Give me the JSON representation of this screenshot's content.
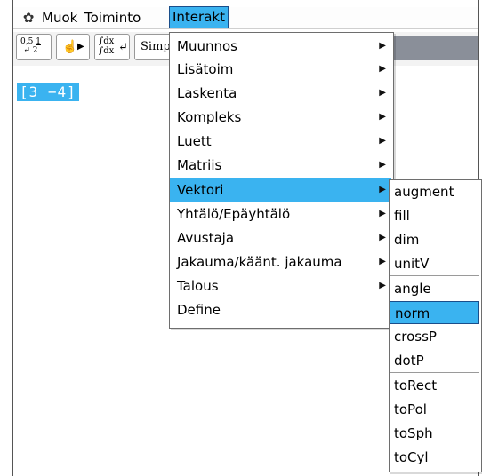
{
  "menubar": {
    "gear_icon": "gear-icon",
    "items": [
      "Muok",
      "Toiminto",
      "Interakt"
    ],
    "active_index": 2
  },
  "toolbar": {
    "fraction_button": "0,5 1/2",
    "hand_button": "hand-pointer-play",
    "integral_button": "∫dx",
    "simp_label": "Simp"
  },
  "workspace": {
    "expression": "[3 −4]"
  },
  "interakt_menu": {
    "items": [
      {
        "label": "Muunnos",
        "has_submenu": true
      },
      {
        "label": "Lisätoim",
        "has_submenu": true
      },
      {
        "label": "Laskenta",
        "has_submenu": true
      },
      {
        "label": "Kompleks",
        "has_submenu": true
      },
      {
        "label": "Luett",
        "has_submenu": true
      },
      {
        "label": "Matriis",
        "has_submenu": true
      },
      {
        "label": "Vektori",
        "has_submenu": true,
        "selected": true
      },
      {
        "label": "Yhtälö/Epäyhtälö",
        "has_submenu": true
      },
      {
        "label": "Avustaja",
        "has_submenu": true
      },
      {
        "label": "Jakauma/käänt. jakauma",
        "has_submenu": true
      },
      {
        "label": "Talous",
        "has_submenu": true
      },
      {
        "label": "Define",
        "has_submenu": false
      }
    ]
  },
  "vektori_submenu": {
    "items": [
      {
        "label": "augment"
      },
      {
        "label": "fill"
      },
      {
        "label": "dim"
      },
      {
        "label": "unitV"
      },
      {
        "label": "angle"
      },
      {
        "label": "norm",
        "selected": true
      },
      {
        "label": "crossP"
      },
      {
        "label": "dotP"
      },
      {
        "label": "toRect"
      },
      {
        "label": "toPol"
      },
      {
        "label": "toSph"
      },
      {
        "label": "toCyl"
      }
    ]
  },
  "colors": {
    "highlight": "#3ab3f0",
    "highlight_border": "#1a4e8a"
  }
}
